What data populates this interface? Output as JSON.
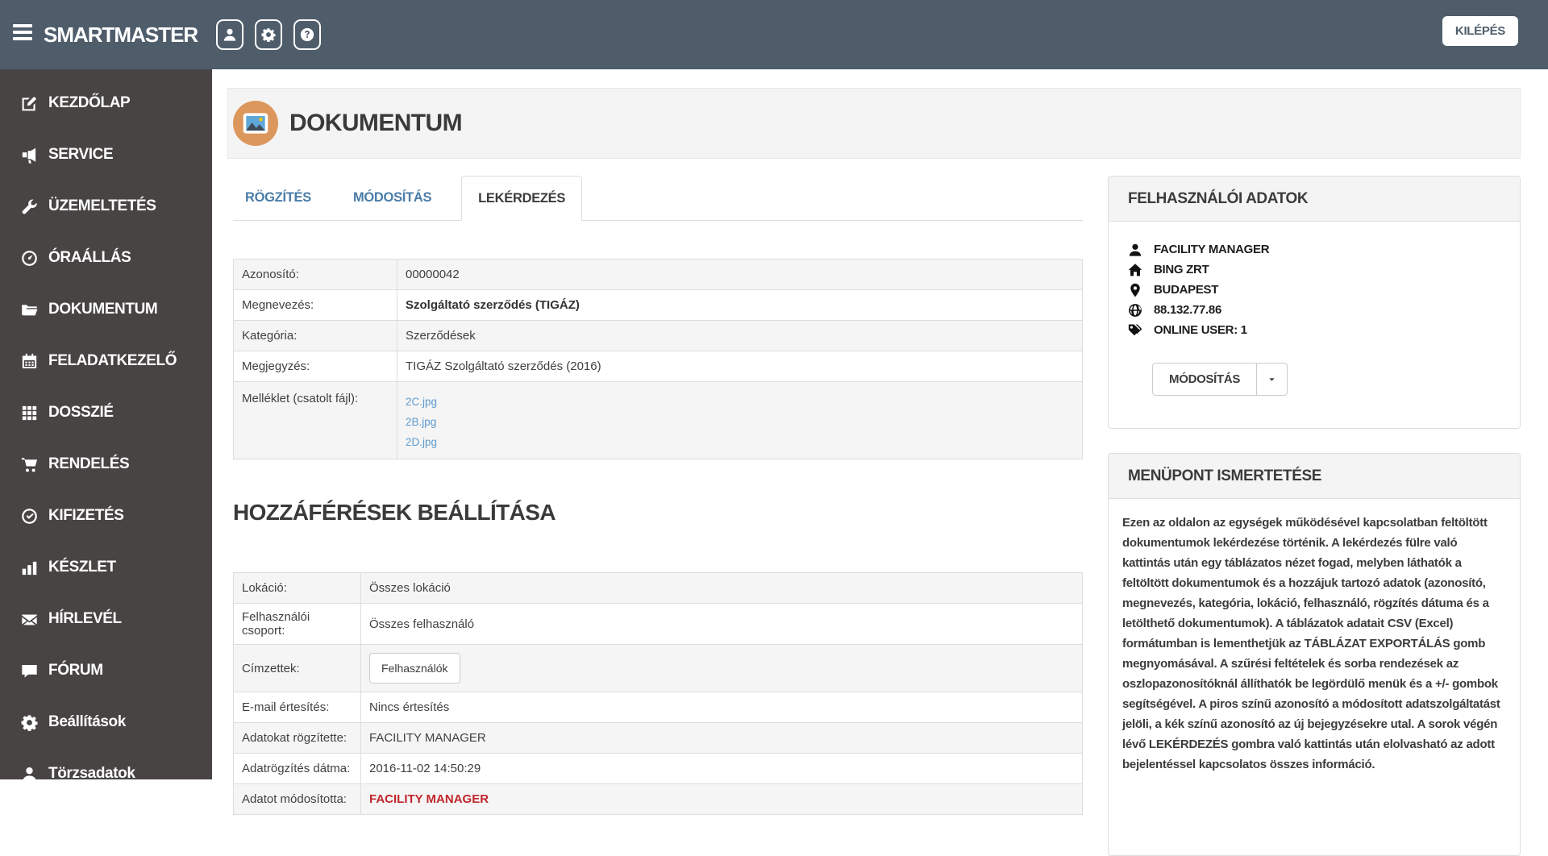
{
  "topbar": {
    "brand": "SMARTMASTER",
    "icon_buttons": [
      {
        "icon": "user"
      },
      {
        "icon": "gear"
      },
      {
        "icon": "question"
      }
    ],
    "logout_label": "KILÉPÉS"
  },
  "sidebar": {
    "items": [
      {
        "label": "KEZDŐLAP",
        "icon": "edit"
      },
      {
        "label": "SERVICE",
        "icon": "megaphone"
      },
      {
        "label": "ÜZEMELTETÉS",
        "icon": "wrench"
      },
      {
        "label": "ÓRAÁLLÁS",
        "icon": "gauge"
      },
      {
        "label": "DOKUMENTUM",
        "icon": "folder"
      },
      {
        "label": "FELADATKEZELŐ",
        "icon": "calendar"
      },
      {
        "label": "DOSSZIÉ",
        "icon": "grid"
      },
      {
        "label": "RENDELÉS",
        "icon": "cart"
      },
      {
        "label": "KIFIZETÉS",
        "icon": "check-circle"
      },
      {
        "label": "KÉSZLET",
        "icon": "bar-chart"
      },
      {
        "label": "HÍRLEVÉL",
        "icon": "envelope"
      },
      {
        "label": "FÓRUM",
        "icon": "comment"
      },
      {
        "label": "Beállítások",
        "icon": "gear"
      },
      {
        "label": "Törzsadatok",
        "icon": "user"
      }
    ]
  },
  "page": {
    "title": "DOKUMENTUM",
    "icon": "image",
    "tabs": [
      {
        "label": "RÖGZÍTÉS",
        "active": false
      },
      {
        "label": "MÓDOSÍTÁS",
        "active": false
      },
      {
        "label": "LEKÉRDEZÉS",
        "active": true
      }
    ]
  },
  "document_table": {
    "rows": [
      {
        "label": "Azonosító:",
        "value": "00000042"
      },
      {
        "label": "Megnevezés:",
        "value": "Szolgáltató szerződés (TIGÁZ)",
        "bold": true
      },
      {
        "label": "Kategória:",
        "value": "Szerződések"
      },
      {
        "label": "Megjegyzés:",
        "value": "TIGÁZ Szolgáltató szerződés (2016)"
      },
      {
        "label": "Melléklet (csatolt fájl):",
        "attachments": [
          "2C.jpg",
          "2B.jpg",
          "2D.jpg"
        ]
      }
    ]
  },
  "access_section": {
    "title": "HOZZÁFÉRÉSEK BEÁLLÍTÁSA",
    "rows": [
      {
        "label": "Lokáció:",
        "value": "Összes lokáció"
      },
      {
        "label": "Felhasználói csoport:",
        "value": "Összes felhasználó"
      },
      {
        "label": "Címzettek:",
        "button": "Felhasználók"
      },
      {
        "label": "E-mail értesítés:",
        "value": "Nincs értesítés"
      },
      {
        "label": "Adatokat rögzítette:",
        "value": "FACILITY MANAGER"
      },
      {
        "label": "Adatrögzítés dátma:",
        "value": "2016-11-02 14:50:29"
      },
      {
        "label": "Adatot módosította:",
        "value": "FACILITY MANAGER",
        "red": true
      }
    ]
  },
  "user_panel": {
    "title": "FELHASZNÁLÓI ADATOK",
    "items": [
      {
        "icon": "user",
        "text": "FACILITY MANAGER"
      },
      {
        "icon": "home",
        "text": "BING ZRT"
      },
      {
        "icon": "map-marker",
        "text": "BUDAPEST"
      },
      {
        "icon": "globe",
        "text": "88.132.77.86"
      },
      {
        "icon": "tags",
        "text": "ONLINE USER: 1"
      }
    ],
    "button_label": "MÓDOSÍTÁS",
    "caret_icon": "caret-down"
  },
  "info_panel": {
    "title": "MENÜPONT ISMERTETÉSE",
    "body": "Ezen az oldalon az egységek működésével kapcsolatban feltöltött dokumentumok lekérdezése történik. A lekérdezés fülre való kattintás után egy táblázatos nézet fogad, melyben láthatók a feltöltött dokumentumok és a hozzájuk tartozó adatok (azonosító, megnevezés, kategória, lokáció, felhasználó, rögzítés dátuma és a letölthető dokumentumok). A táblázatok adatait CSV (Excel) formátumban is lementhetjük az TÁBLÁZAT EXPORTÁLÁS gomb megnyomásával. A szűrési feltételek és sorba rendezések az oszlopazonosítóknál állíthatók be legördülő menük és a +/- gombok segítségével. A piros színű azonosító a módosított adatszolgáltatást jelöli, a kék színű azonosító az új bejegyzésekre utal. A sorok végén lévő LEKÉRDEZÉS gombra való kattintás után elolvasható az adott bejelentéssel kapcsolatos összes információ."
  },
  "colors": {
    "topbar_bg": "#4f5d6b",
    "sidebar_bg": "#474443",
    "panel_header_bg": "#f4f4f4",
    "border": "#dddddd",
    "accent_orange": "#dc975c",
    "tab_link_blue": "#4a7ca8",
    "attachment_link_blue": "#5e9bcd",
    "red_value": "#c0262c",
    "dark_text": "#3b3b3b"
  }
}
